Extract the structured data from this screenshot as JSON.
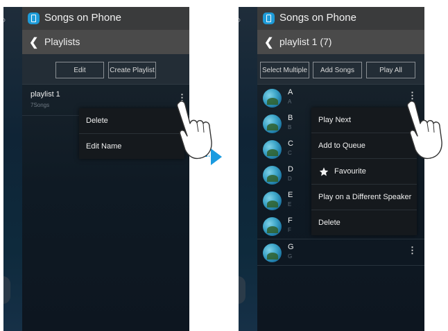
{
  "left_screen": {
    "app_title": "Songs on Phone",
    "sub_title": "Playlists",
    "buttons": [
      "Edit",
      "Create Playlist"
    ],
    "playlist": {
      "name": "playlist 1",
      "count": "7Songs"
    },
    "menu": [
      "Delete",
      "Edit Name"
    ]
  },
  "right_screen": {
    "app_title": "Songs on Phone",
    "sub_title": "playlist 1 (7)",
    "buttons": [
      "Select Multiple",
      "Add Songs",
      "Play All"
    ],
    "songs": [
      {
        "title": "A",
        "sub": "A"
      },
      {
        "title": "B",
        "sub": "B"
      },
      {
        "title": "C",
        "sub": "C"
      },
      {
        "title": "D",
        "sub": "D"
      },
      {
        "title": "E",
        "sub": "E"
      },
      {
        "title": "F",
        "sub": "F"
      },
      {
        "title": "G",
        "sub": "G"
      }
    ],
    "menu": [
      "Play Next",
      "Add to Queue",
      "Favourite",
      "Play on a Different Speaker",
      "Delete"
    ]
  },
  "colors": {
    "accent": "#1e9bd8",
    "arrow": "#1a9be0",
    "appbar": "#3a3b3c",
    "subbar": "#4a4a4a"
  },
  "icons": [
    "phone-app-icon",
    "back-chevron-icon",
    "more-vert-icon",
    "star-icon",
    "hand-pointer-icon",
    "arrow-right-icon"
  ]
}
